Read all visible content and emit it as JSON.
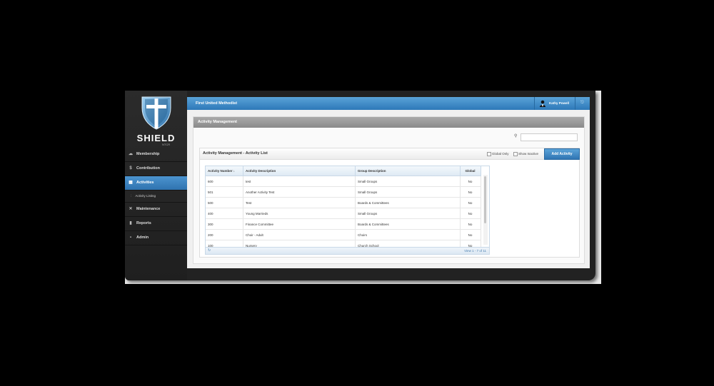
{
  "brand": {
    "name": "SHIELD",
    "sub": "NTCR"
  },
  "sidebar": {
    "items": [
      {
        "icon": "cloud-icon",
        "glyph": "☁",
        "label": "Membership",
        "active": false
      },
      {
        "icon": "dollar-icon",
        "glyph": "$",
        "label": "Contribution",
        "active": false
      },
      {
        "icon": "calendar-icon",
        "glyph": "▦",
        "label": "Activities",
        "active": true
      },
      {
        "icon": "wrench-icon",
        "glyph": "✕",
        "label": "Maintenance",
        "active": false
      },
      {
        "icon": "chart-icon",
        "glyph": "▮",
        "label": "Reports",
        "active": false
      },
      {
        "icon": "grid-icon",
        "glyph": "▪",
        "label": "Admin",
        "active": false
      }
    ],
    "sub_item": "Activity Listing"
  },
  "header": {
    "org": "First United Methodist",
    "user": "Kathy Powell"
  },
  "panel": {
    "title": "Activity Management",
    "search_value": ""
  },
  "list": {
    "title": "Activity Management - Activity List",
    "global_only": "Global Only",
    "show_inactive": "Show Inactive",
    "add_button": "Add Activity",
    "columns": [
      "Activity Number",
      "Activity Description",
      "Group Description",
      "Global"
    ],
    "sort_glyph": "↓",
    "rows": [
      [
        "600",
        "test",
        "Small Groups",
        "No"
      ],
      [
        "501",
        "Another Activity Test",
        "Small Groups",
        "No"
      ],
      [
        "500",
        "Test",
        "Boards & Committees",
        "No"
      ],
      [
        "400",
        "Young Marrieds",
        "Small Groups",
        "No"
      ],
      [
        "300",
        "Finance Committee",
        "Boards & Committees",
        "No"
      ],
      [
        "200",
        "Choir - Adult",
        "Choirs",
        "No"
      ],
      [
        "100",
        "Nursery",
        "Church School",
        "No"
      ]
    ],
    "pager": "View 1 - 7 of 11",
    "refresh_glyph": "↻"
  }
}
